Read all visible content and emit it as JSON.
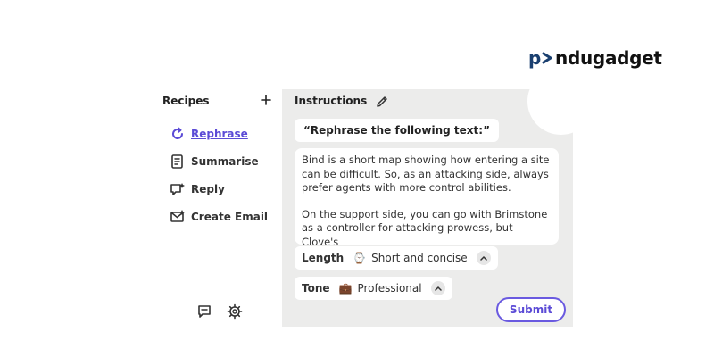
{
  "brand": {
    "part1": "p",
    "part2": "ndugadget"
  },
  "recipes": {
    "title": "Recipes",
    "add_icon": "plus-icon",
    "items": [
      {
        "label": "Rephrase",
        "icon": "refresh-icon",
        "active": true
      },
      {
        "label": "Summarise",
        "icon": "document-icon",
        "active": false
      },
      {
        "label": "Reply",
        "icon": "chat-sparkle-icon",
        "active": false
      },
      {
        "label": "Create Email",
        "icon": "email-icon",
        "active": false
      }
    ],
    "footer": {
      "feedback_icon": "feedback-icon",
      "settings_icon": "gear-icon"
    }
  },
  "instructions": {
    "title": "Instructions",
    "edit_icon": "pencil-icon",
    "prompt": "“Rephrase the following text:”",
    "body_paragraphs": [
      "Bind is a short map showing how entering a site can be difficult. So, as an attacking side, always prefer agents with more control abilities.",
      "On the support side, you can go with Brimstone as a controller for attacking prowess, but Clove's"
    ],
    "length": {
      "label": "Length",
      "emoji": "⌚",
      "value": "Short and concise"
    },
    "tone": {
      "label": "Tone",
      "emoji": "💼",
      "value": "Professional"
    },
    "submit": "Submit"
  },
  "colors": {
    "accent": "#5b4bd6",
    "panel_bg": "#ececeb",
    "brand_blue": "#1a3f6f"
  }
}
